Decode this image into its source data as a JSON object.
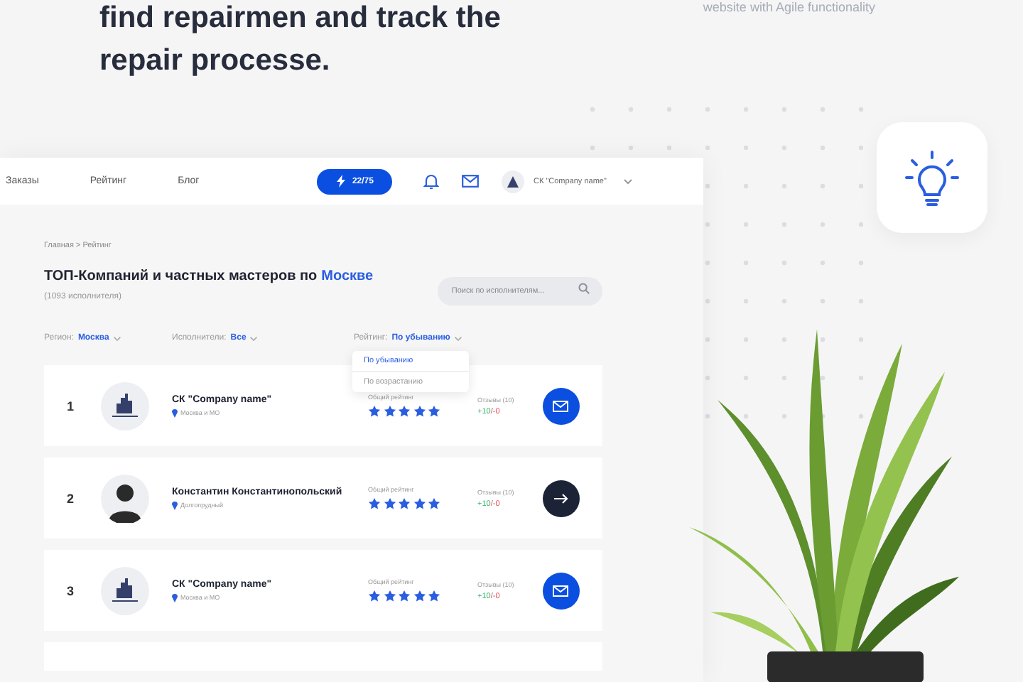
{
  "heading_lines": [
    "find repairmen and track the",
    "repair processe."
  ],
  "tagline": "website with Agile functionality",
  "screen": {
    "nav": [
      {
        "label": "Заказы",
        "selected": false
      },
      {
        "label": "Рейтинг",
        "selected": false
      },
      {
        "label": "Блог",
        "selected": false
      }
    ],
    "balance_button": "22/75",
    "account": "СК \"Company name\"",
    "breadcrumb": "Главная > Рейтинг",
    "title": "ТОП-Компаний и частных мастеров по",
    "title_city": "Москве",
    "count": "(1093 исполнителя)",
    "search": {
      "placeholder": "Поиск по исполнителям..."
    },
    "filters": [
      {
        "label": "Регион:",
        "value": "Москва"
      },
      {
        "label": "Исполнители:",
        "value": "Все"
      },
      {
        "label": "Рейтинг:",
        "value": "По убыванию"
      }
    ],
    "sort_menu": [
      {
        "label": "По убыванию",
        "selected": true
      },
      {
        "label": "По возрастанию",
        "selected": false
      }
    ],
    "rows": [
      {
        "rank": "1",
        "kind": "company",
        "name": "СК \"Company name\"",
        "location": "Москва и МО",
        "rating_label": "Общий рейтинг",
        "stars": 5,
        "reviews_label": "Отзывы (10)",
        "plus": "+10",
        "minus": "/-0",
        "button": {
          "kind": "mail"
        }
      },
      {
        "rank": "2",
        "kind": "person",
        "name": "Константин Константинопольский",
        "location": "Долгопрудный",
        "rating_label": "Общий рейтинг",
        "stars": 5,
        "reviews_label": "Отзывы (10)",
        "plus": "+10",
        "minus": "/-0",
        "button": {
          "kind": "arrow"
        }
      },
      {
        "rank": "3",
        "kind": "company",
        "name": "СК \"Company name\"",
        "location": "Москва и МО",
        "rating_label": "Общий рейтинг",
        "stars": 5,
        "reviews_label": "Отзывы (10)",
        "plus": "+10",
        "minus": "/-0",
        "button": {
          "kind": "mail"
        }
      }
    ]
  }
}
